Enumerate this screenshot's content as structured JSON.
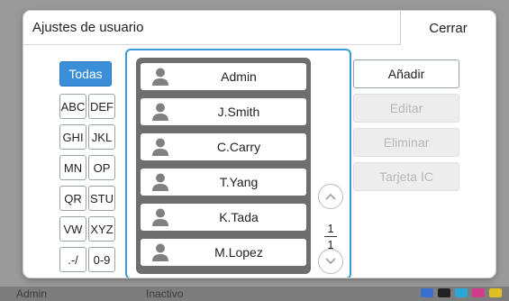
{
  "dialog": {
    "title": "Ajustes de usuario",
    "close_label": "Cerrar"
  },
  "filters": {
    "all_label": "Todas",
    "groups": [
      "ABC",
      "DEF",
      "GHI",
      "JKL",
      "MN",
      "OP",
      "QR",
      "STU",
      "VW",
      "XYZ",
      ".-/",
      "0-9"
    ]
  },
  "users": [
    "Admin",
    "J.Smith",
    "C.Carry",
    "T.Yang",
    "K.Tada",
    "M.Lopez"
  ],
  "pagination": {
    "current_page": "1",
    "total_pages": "1"
  },
  "actions": {
    "add_label": "Añadir",
    "edit_label": "Editar",
    "delete_label": "Eliminar",
    "ic_card_label": "Tarjeta IC"
  },
  "background_status": {
    "user": "Admin",
    "state": "Inactivo"
  },
  "colors": {
    "accent": "#3b8fd8",
    "panel_border": "#3a9ad9",
    "list_frame": "#6e6e6e",
    "icon_gray": "#808080"
  }
}
